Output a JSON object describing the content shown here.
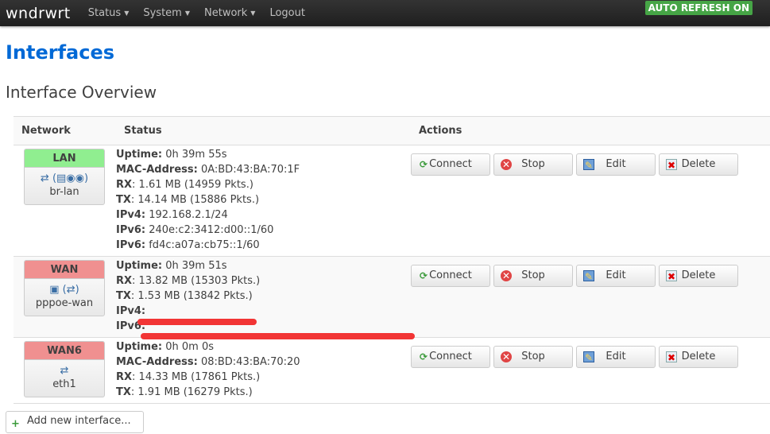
{
  "nav": {
    "brand": "wndrwrt",
    "menus": [
      "Status",
      "System",
      "Network",
      "Logout"
    ],
    "auto_refresh": "AUTO REFRESH ON"
  },
  "page": {
    "title": "Interfaces",
    "subtitle": "Interface Overview"
  },
  "table": {
    "headers": [
      "Network",
      "Status",
      "Actions"
    ],
    "rows": [
      {
        "name": "LAN",
        "color": "#90ee90",
        "icons": "⇄ (▤◉◉)",
        "ifname": "br-lan",
        "status": [
          [
            "Uptime:",
            "0h 39m 55s"
          ],
          [
            "MAC-Address:",
            "0A:BD:43:BA:70:1F"
          ],
          [
            "RX",
            ": 1.61 MB (14959 Pkts.)"
          ],
          [
            "TX",
            ": 14.14 MB (15886 Pkts.)"
          ],
          [
            "IPv4:",
            "192.168.2.1/24"
          ],
          [
            "IPv6:",
            "240e:c2:3412:d00::1/60"
          ],
          [
            "IPv6:",
            "fd4c:a07a:cb75::1/60"
          ]
        ]
      },
      {
        "name": "WAN",
        "color": "#f09090",
        "icons": "▣ (⇄)",
        "ifname": "pppoe-wan",
        "status": [
          [
            "Uptime:",
            "0h 39m 51s"
          ],
          [
            "RX",
            ": 13.82 MB (15303 Pkts.)"
          ],
          [
            "TX",
            ": 1.53 MB (13842 Pkts.)"
          ],
          [
            "IPv4:",
            ""
          ],
          [
            "IPv6:",
            ""
          ]
        ]
      },
      {
        "name": "WAN6",
        "color": "#f09090",
        "icons": "⇄",
        "ifname": "eth1",
        "status": [
          [
            "Uptime:",
            "0h 0m 0s"
          ],
          [
            "MAC-Address:",
            "08:BD:43:BA:70:20"
          ],
          [
            "RX",
            ": 14.33 MB (17861 Pkts.)"
          ],
          [
            "TX",
            ": 1.91 MB (16279 Pkts.)"
          ]
        ]
      }
    ]
  },
  "actions": [
    {
      "label": "Connect",
      "icon": "connect-icon"
    },
    {
      "label": "Stop",
      "icon": "stop-icon"
    },
    {
      "label": "Edit",
      "icon": "edit-icon"
    },
    {
      "label": "Delete",
      "icon": "delete-icon"
    }
  ],
  "add_button": "Add new interface..."
}
